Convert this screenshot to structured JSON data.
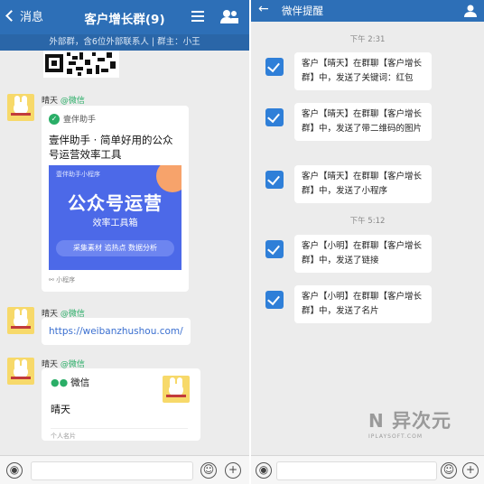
{
  "left": {
    "header": {
      "back": "消息",
      "title": "客户增长群(9)",
      "sub": "外部群，含6位外部联系人 | 群主：小王"
    },
    "messages": [
      {
        "sender": "晴天",
        "source": "@微信"
      },
      {
        "sender": "晴天",
        "source": "@微信"
      },
      {
        "sender": "晴天",
        "source": "@微信"
      }
    ],
    "mp_card": {
      "brand": "壹伴助手",
      "title": "壹伴助手 · 简单好用的公众号运营效率工具",
      "banner_small": "壹伴助手小程序",
      "banner_big": "公众号运营",
      "banner_mid": "效率工具箱",
      "banner_pill": "采集素材  追热点  数据分析",
      "footer": "小程序"
    },
    "link_text": "https://weibanzhushou.com/",
    "contact_card": {
      "platform": "微信",
      "name": "晴天",
      "type": "个人名片"
    }
  },
  "right": {
    "header": {
      "title": "微伴提醒"
    },
    "groups": [
      {
        "time": "下午 2:31",
        "items": [
          "客户【晴天】在群聊【客户增长群】中，发送了关键词：红包",
          "客户【晴天】在群聊【客户增长群】中，发送了带二维码的图片",
          "客户【晴天】在群聊【客户增长群】中，发送了小程序"
        ]
      },
      {
        "time": "下午 5:12",
        "items": [
          "客户【小明】在群聊【客户增长群】中，发送了链接",
          "客户【小明】在群聊【客户增长群】中，发送了名片"
        ]
      }
    ]
  },
  "watermark": {
    "text": "异次元",
    "small": "IPLAYSOFT.COM"
  },
  "colors": {
    "accent": "#2d6fb7",
    "wechat_green": "#2aae67",
    "check": "#2f7fd8"
  }
}
